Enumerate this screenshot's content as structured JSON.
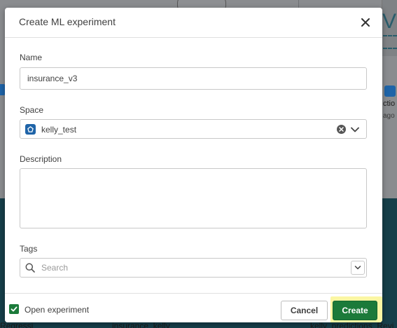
{
  "background": {
    "right_texts": [
      "ctio",
      "ago"
    ],
    "bottom_labels": [
      "Regressi",
      "insurance_kelly",
      "kelly_predictions_Revi"
    ],
    "big_letter": "V"
  },
  "dialog": {
    "title": "Create ML experiment",
    "close_icon": "close-icon",
    "name": {
      "label": "Name",
      "value": "insurance_v3"
    },
    "space": {
      "label": "Space",
      "value": "kelly_test",
      "icon": "space-icon",
      "clear_icon": "clear-icon",
      "chevron_icon": "chevron-down-icon"
    },
    "description": {
      "label": "Description",
      "value": ""
    },
    "tags": {
      "label": "Tags",
      "placeholder": "Search",
      "search_icon": "search-icon"
    },
    "footer": {
      "open_experiment_label": "Open experiment",
      "open_experiment_checked": true,
      "cancel_label": "Cancel",
      "create_label": "Create"
    }
  },
  "colors": {
    "accent_green": "#1b7a3a",
    "space_blue": "#1f64a8",
    "create_highlight": "#fbf6a3",
    "overlay": "#7d7f82"
  }
}
